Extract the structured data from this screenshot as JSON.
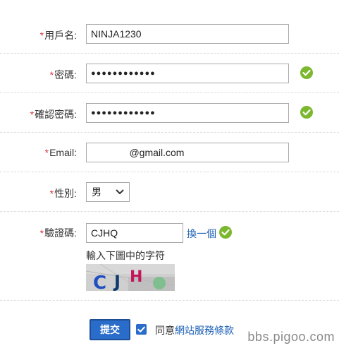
{
  "form": {
    "username": {
      "label": "用戶名:",
      "value": "NINJA1230"
    },
    "password": {
      "label": "密碼:",
      "value": "●●●●●●●●●●●●"
    },
    "confirm_password": {
      "label": "確認密碼:",
      "value": "●●●●●●●●●●●●"
    },
    "email": {
      "label": "Email:",
      "value": "              @gmail.com"
    },
    "gender": {
      "label": "性別:",
      "value": "男"
    },
    "captcha": {
      "label": "驗證碼:",
      "value": "CJHQ",
      "refresh_label": "換一個",
      "hint": "輸入下圖中的字符"
    },
    "required_mark": "*",
    "submit_label": "提交",
    "agree_prefix": "同意",
    "agree_link": "網站服務條款"
  },
  "watermark": "bbs.pigoo.com",
  "colors": {
    "required": "#d9363e",
    "accent": "#2a6cc9",
    "ok": "#7cb82f",
    "link": "#1b5fb4"
  }
}
